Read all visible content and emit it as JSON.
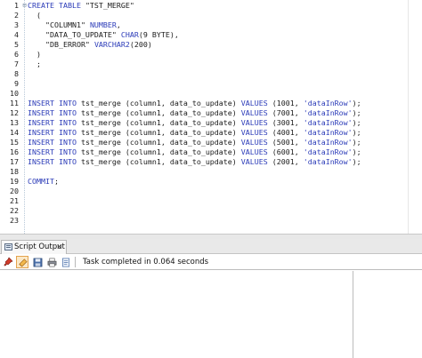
{
  "editor": {
    "lines": [
      {
        "n": "1",
        "tokens": [
          {
            "t": "CREATE TABLE ",
            "c": "kw"
          },
          {
            "t": "\"TST_MERGE\"",
            "c": "plain"
          }
        ]
      },
      {
        "n": "2",
        "tokens": [
          {
            "t": "  (",
            "c": "plain"
          }
        ]
      },
      {
        "n": "3",
        "tokens": [
          {
            "t": "    \"COLUMN1\" ",
            "c": "plain"
          },
          {
            "t": "NUMBER",
            "c": "typ"
          },
          {
            "t": ",",
            "c": "plain"
          }
        ]
      },
      {
        "n": "4",
        "tokens": [
          {
            "t": "    \"DATA_TO_UPDATE\" ",
            "c": "plain"
          },
          {
            "t": "CHAR",
            "c": "typ"
          },
          {
            "t": "(9 BYTE),",
            "c": "plain"
          }
        ]
      },
      {
        "n": "5",
        "tokens": [
          {
            "t": "    \"DB_ERROR\" ",
            "c": "plain"
          },
          {
            "t": "VARCHAR2",
            "c": "typ"
          },
          {
            "t": "(200)",
            "c": "plain"
          }
        ]
      },
      {
        "n": "6",
        "tokens": [
          {
            "t": "  )",
            "c": "plain"
          }
        ]
      },
      {
        "n": "7",
        "tokens": [
          {
            "t": "  ;",
            "c": "plain"
          }
        ]
      },
      {
        "n": "8",
        "tokens": []
      },
      {
        "n": "9",
        "tokens": []
      },
      {
        "n": "10",
        "tokens": []
      },
      {
        "n": "11",
        "tokens": [
          {
            "t": "INSERT INTO ",
            "c": "kw"
          },
          {
            "t": "tst_merge (column1, data_to_update) ",
            "c": "plain"
          },
          {
            "t": "VALUES ",
            "c": "kw"
          },
          {
            "t": "(1001, ",
            "c": "plain"
          },
          {
            "t": "'dataInRow'",
            "c": "kw"
          },
          {
            "t": ");",
            "c": "plain"
          }
        ]
      },
      {
        "n": "12",
        "tokens": [
          {
            "t": "INSERT INTO ",
            "c": "kw"
          },
          {
            "t": "tst_merge (column1, data_to_update) ",
            "c": "plain"
          },
          {
            "t": "VALUES ",
            "c": "kw"
          },
          {
            "t": "(7001, ",
            "c": "plain"
          },
          {
            "t": "'dataInRow'",
            "c": "kw"
          },
          {
            "t": ");",
            "c": "plain"
          }
        ]
      },
      {
        "n": "13",
        "tokens": [
          {
            "t": "INSERT INTO ",
            "c": "kw"
          },
          {
            "t": "tst_merge (column1, data_to_update) ",
            "c": "plain"
          },
          {
            "t": "VALUES ",
            "c": "kw"
          },
          {
            "t": "(3001, ",
            "c": "plain"
          },
          {
            "t": "'dataInRow'",
            "c": "kw"
          },
          {
            "t": ");",
            "c": "plain"
          }
        ]
      },
      {
        "n": "14",
        "tokens": [
          {
            "t": "INSERT INTO ",
            "c": "kw"
          },
          {
            "t": "tst_merge (column1, data_to_update) ",
            "c": "plain"
          },
          {
            "t": "VALUES ",
            "c": "kw"
          },
          {
            "t": "(4001, ",
            "c": "plain"
          },
          {
            "t": "'dataInRow'",
            "c": "kw"
          },
          {
            "t": ");",
            "c": "plain"
          }
        ]
      },
      {
        "n": "15",
        "tokens": [
          {
            "t": "INSERT INTO ",
            "c": "kw"
          },
          {
            "t": "tst_merge (column1, data_to_update) ",
            "c": "plain"
          },
          {
            "t": "VALUES ",
            "c": "kw"
          },
          {
            "t": "(5001, ",
            "c": "plain"
          },
          {
            "t": "'dataInRow'",
            "c": "kw"
          },
          {
            "t": ");",
            "c": "plain"
          }
        ]
      },
      {
        "n": "16",
        "tokens": [
          {
            "t": "INSERT INTO ",
            "c": "kw"
          },
          {
            "t": "tst_merge (column1, data_to_update) ",
            "c": "plain"
          },
          {
            "t": "VALUES ",
            "c": "kw"
          },
          {
            "t": "(6001, ",
            "c": "plain"
          },
          {
            "t": "'dataInRow'",
            "c": "kw"
          },
          {
            "t": ");",
            "c": "plain"
          }
        ]
      },
      {
        "n": "17",
        "tokens": [
          {
            "t": "INSERT INTO ",
            "c": "kw"
          },
          {
            "t": "tst_merge (column1, data_to_update) ",
            "c": "plain"
          },
          {
            "t": "VALUES ",
            "c": "kw"
          },
          {
            "t": "(2001, ",
            "c": "plain"
          },
          {
            "t": "'dataInRow'",
            "c": "kw"
          },
          {
            "t": ");",
            "c": "plain"
          }
        ]
      },
      {
        "n": "18",
        "tokens": []
      },
      {
        "n": "19",
        "tokens": [
          {
            "t": "COMMIT",
            "c": "kw"
          },
          {
            "t": ";",
            "c": "plain"
          }
        ]
      },
      {
        "n": "20",
        "tokens": []
      },
      {
        "n": "21",
        "tokens": []
      },
      {
        "n": "22",
        "tokens": []
      },
      {
        "n": "23",
        "tokens": []
      }
    ]
  },
  "output_panel": {
    "tab_label": "Script Output",
    "tab_close": "×",
    "status": "Task completed in 0.064 seconds",
    "toolbar_icons": [
      "pin-icon",
      "eraser-icon",
      "save-icon",
      "print-icon",
      "open-file-icon"
    ]
  },
  "colors": {
    "keyword": "#2b3bb8",
    "text": "#1a1a1a",
    "active_button_bg": "#fbe8c6",
    "active_button_border": "#e3a34e"
  }
}
